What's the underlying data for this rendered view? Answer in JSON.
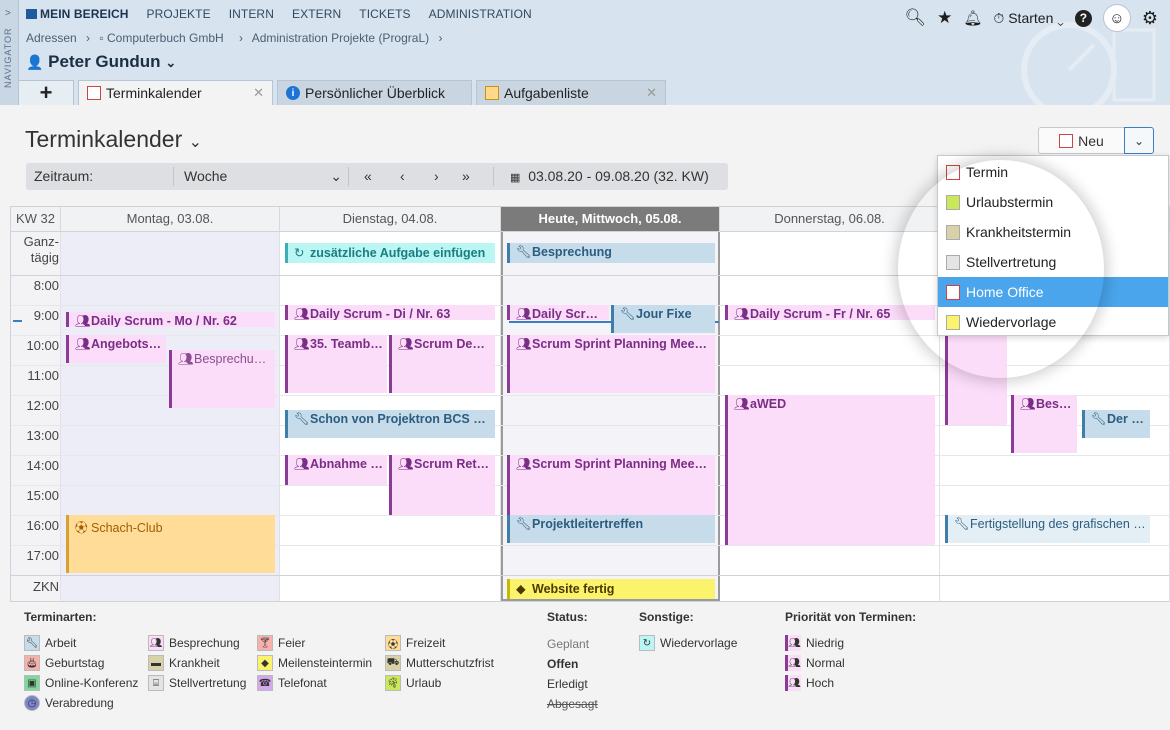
{
  "navigator": {
    "label": "NAVIGATOR",
    "chevron": ">"
  },
  "menu": {
    "items": [
      "MEIN BEREICH",
      "PROJEKTE",
      "INTERN",
      "EXTERN",
      "TICKETS",
      "ADMINISTRATION"
    ]
  },
  "breadcrumb": [
    "Adressen",
    "›",
    "Computerbuch GmbH",
    "›",
    "Administration Projekte (PrograL)",
    "›"
  ],
  "user": {
    "name": "Peter Gundun"
  },
  "topbar": {
    "starten": "Starten"
  },
  "tabs": [
    {
      "label": "Terminkalender",
      "icon": "calendar-icon"
    },
    {
      "label": "Persönlicher Überblick",
      "icon": "info-icon"
    },
    {
      "label": "Aufgabenliste",
      "icon": "tasklist-icon"
    }
  ],
  "page": {
    "title": "Terminkalender",
    "new_label": "Neu"
  },
  "filter": {
    "label": "Zeitraum:",
    "value": "Woche",
    "range": "03.08.20 - 09.08.20 (32. KW)"
  },
  "calendar": {
    "week": "KW 32",
    "days": [
      "Montag, 03.08.",
      "Dienstag, 04.08.",
      "Heute, Mittwoch, 05.08.",
      "Donnerstag, 06.08."
    ],
    "allday_label": "Ganz-\ntägig",
    "zkn_label": "ZKN",
    "hours": [
      "8:00",
      "9:00",
      "10:00",
      "11:00",
      "12:00",
      "13:00",
      "14:00",
      "15:00",
      "16:00",
      "17:00"
    ],
    "events": {
      "e1": "zusätzliche Aufgabe einfügen",
      "e2": "Besprechung",
      "e3": "Daily Scrum - Mo / Nr. 62",
      "e4": "Daily Scrum - Di / Nr. 63",
      "e5": "Daily Scru…",
      "e6": "Jour Fixe",
      "e7": "Daily Scrum - Fr / Nr. 65",
      "e8": "Angebotsb…",
      "e9": "Besprechun…",
      "e10": "35. Teamb…",
      "e11": "Scrum Dem…",
      "e12": "Scrum Sprint Planning Meetin…",
      "e13": "Schon von Projektron BCS üb…",
      "e14": "aWED",
      "e15": "Bes…",
      "e16": "Der …",
      "e17": "Abnahme …",
      "e18": "Scrum Retr…",
      "e19": "Scrum Sprint Planning Meetin…",
      "e20": "Schach-Club",
      "e21": "Projektleitertreffen",
      "e22": "Fertigstellung des grafischen …",
      "e23": "Website fertig"
    }
  },
  "dropdown": {
    "items": [
      "Termin",
      "Urlaubstermin",
      "Krankheitstermin",
      "Stellvertretung",
      "Home Office",
      "Wiedervorlage"
    ],
    "selected": "Home Office"
  },
  "legend": {
    "terminarten_title": "Terminarten:",
    "terminarten": [
      "Arbeit",
      "Geburtstag",
      "Online-Konferenz",
      "Verabredung",
      "Besprechung",
      "Krankheit",
      "Stellvertretung",
      "Feier",
      "Meilensteintermin",
      "Telefonat",
      "Freizeit",
      "Mutterschutzfrist",
      "Urlaub"
    ],
    "status_title": "Status:",
    "status": [
      "Geplant",
      "Offen",
      "Erledigt",
      "Abgesagt"
    ],
    "sonstige_title": "Sonstige:",
    "sonstige": [
      "Wiedervorlage"
    ],
    "prio_title": "Priorität von Terminen:",
    "prio": [
      "Niedrig",
      "Normal",
      "Hoch"
    ]
  },
  "colors": {
    "accent": "#4aa5ec",
    "meeting": "#8b3a95",
    "work": "#3f7ea8",
    "today_header": "#7b7b7b"
  }
}
